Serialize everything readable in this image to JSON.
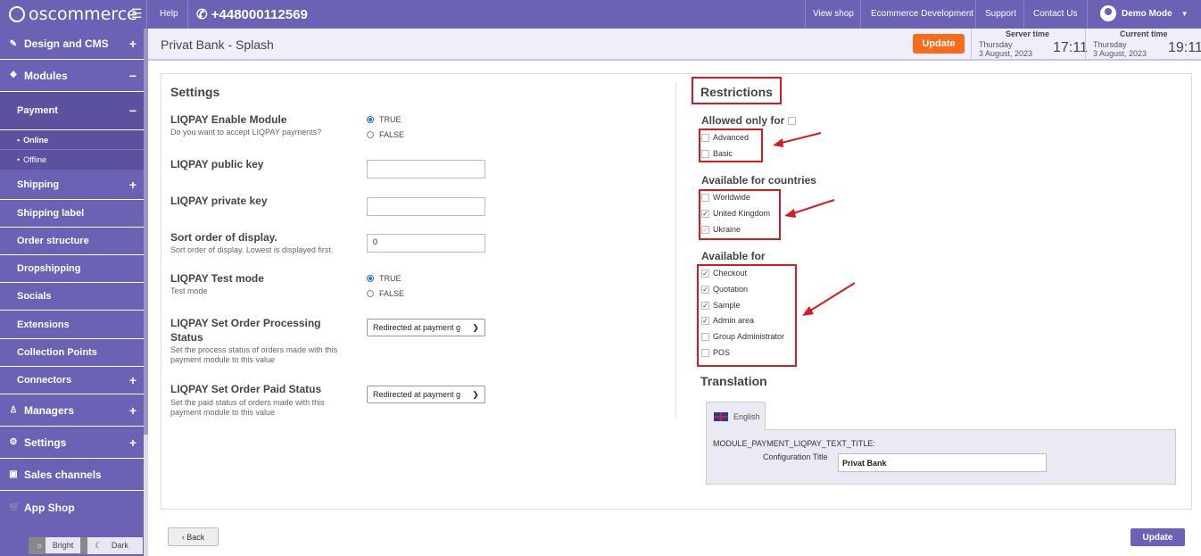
{
  "topbar": {
    "logo": "oscommerce",
    "help": "Help",
    "phone": "+448000112569",
    "links": [
      "View shop",
      "Ecommerce Development",
      "Support",
      "Contact Us"
    ],
    "user": "Demo Mode"
  },
  "sidebar": {
    "items": [
      {
        "label": "Design and CMS",
        "icon": "brush-icon",
        "toggle": "+"
      },
      {
        "label": "Modules",
        "icon": "puzzle-icon",
        "toggle": "−"
      },
      {
        "label": "Payment",
        "toggle": "−"
      },
      {
        "label": "Online"
      },
      {
        "label": "Offline"
      },
      {
        "label": "Shipping",
        "toggle": "+"
      },
      {
        "label": "Shipping label"
      },
      {
        "label": "Order structure"
      },
      {
        "label": "Dropshipping"
      },
      {
        "label": "Socials"
      },
      {
        "label": "Extensions"
      },
      {
        "label": "Collection Points"
      },
      {
        "label": "Connectors",
        "toggle": "+"
      },
      {
        "label": "Managers",
        "icon": "user-icon",
        "toggle": "+"
      },
      {
        "label": "Settings",
        "icon": "gear-icon",
        "toggle": "+"
      },
      {
        "label": "Sales channels",
        "icon": "monitor-icon"
      },
      {
        "label": "App Shop",
        "icon": "cart-icon"
      }
    ],
    "theme": {
      "bright": "Bright",
      "dark": "Dark"
    }
  },
  "header": {
    "title": "Privat Bank - Splash",
    "update": "Update",
    "server_time": {
      "label": "Server time",
      "day": "Thursday",
      "date": "3 August, 2023",
      "time": "17:11"
    },
    "current_time": {
      "label": "Current time",
      "day": "Thursday",
      "date": "3 August, 2023",
      "time": "19:11"
    }
  },
  "settings": {
    "heading": "Settings",
    "enable": {
      "label": "LIQPAY Enable Module",
      "desc": "Do you want to accept LIQPAY payments?",
      "opt_true": "TRUE",
      "opt_false": "FALSE",
      "value": "TRUE"
    },
    "public_key": {
      "label": "LIQPAY public key",
      "value": ""
    },
    "private_key": {
      "label": "LIQPAY private key",
      "value": ""
    },
    "sort_order": {
      "label": "Sort order of display.",
      "desc": "Sort order of display. Lowest is displayed first.",
      "value": "0"
    },
    "test_mode": {
      "label": "LIQPAY Test mode",
      "desc": "Test mode",
      "opt_true": "TRUE",
      "opt_false": "FALSE",
      "value": "TRUE"
    },
    "processing_status": {
      "label": "LIQPAY Set Order Processing Status",
      "desc": "Set the process status of orders made with this payment module to this value",
      "value": "Redirected at payment g"
    },
    "paid_status": {
      "label": "LIQPAY Set Order Paid Status",
      "desc": "Set the paid status of orders made with this payment module to this value",
      "value": "Redirected at payment g"
    }
  },
  "restrictions": {
    "heading": "Restrictions",
    "allowed_only_for": {
      "label": "Allowed only for",
      "items": [
        {
          "label": "Advanced",
          "checked": false
        },
        {
          "label": "Basic",
          "checked": false
        }
      ]
    },
    "countries": {
      "label": "Available for countries",
      "items": [
        {
          "label": "Worldwide",
          "checked": false
        },
        {
          "label": "United Kingdom",
          "checked": true
        },
        {
          "label": "Ukraine",
          "checked": true
        }
      ]
    },
    "available_for": {
      "label": "Available for",
      "items": [
        {
          "label": "Checkout",
          "checked": true
        },
        {
          "label": "Quotation",
          "checked": true
        },
        {
          "label": "Sample",
          "checked": true
        },
        {
          "label": "Admin area",
          "checked": true
        },
        {
          "label": "Group Administrator",
          "checked": false
        },
        {
          "label": "POS",
          "checked": false
        }
      ]
    }
  },
  "translation": {
    "heading": "Translation",
    "tab": "English",
    "key": "MODULE_PAYMENT_LIQPAY_TEXT_TITLE:",
    "field_label": "Configuration Title",
    "value": "Privat Bank"
  },
  "footer": {
    "back": "Back",
    "update": "Update"
  },
  "colors": {
    "brand": "#6b61b5",
    "accent": "#f76b1c",
    "annotation": "#d71920"
  }
}
